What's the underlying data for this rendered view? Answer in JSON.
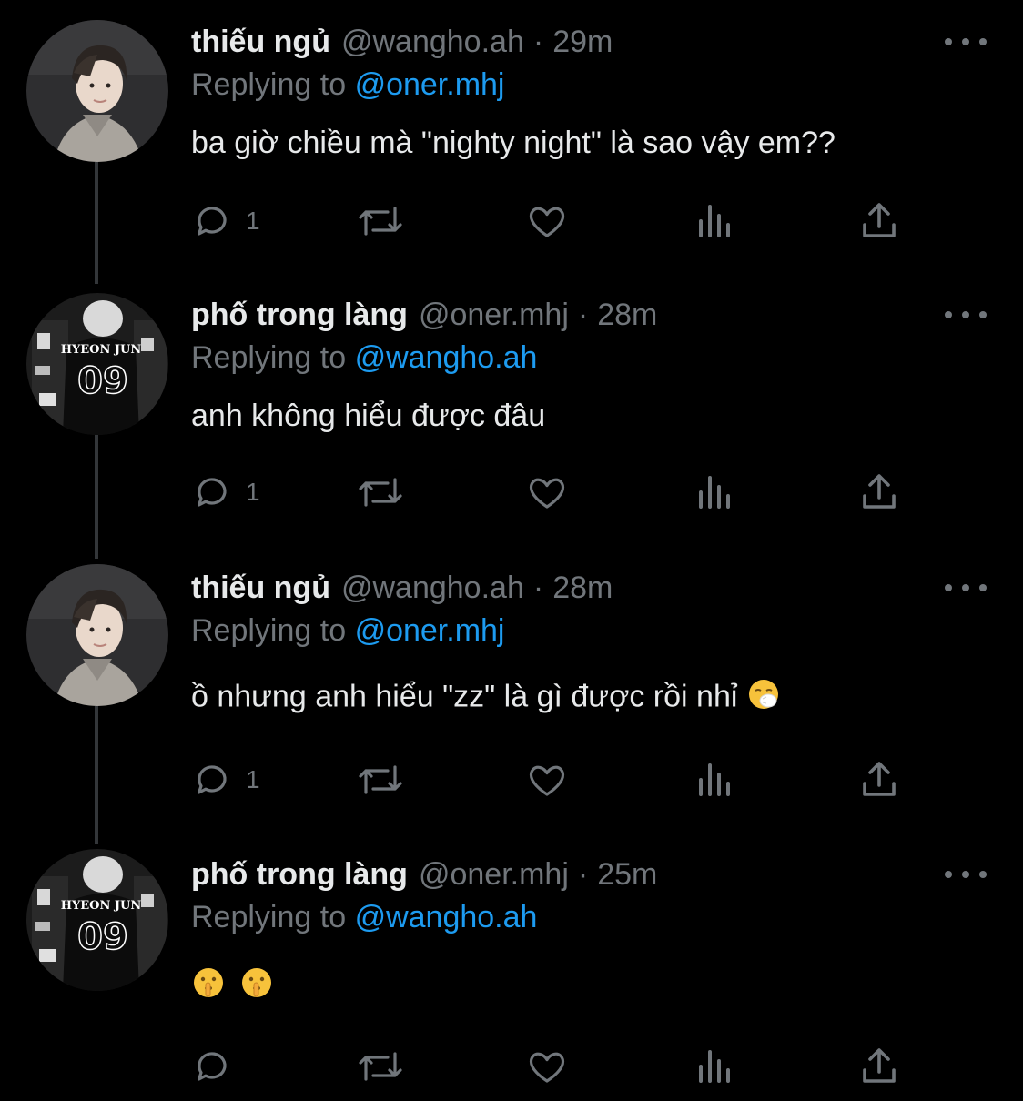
{
  "tweets": [
    {
      "name": "thiếu ngủ",
      "handle": "@wangho.ah",
      "separator": "·",
      "time": "29m",
      "replying_prefix": "Replying to",
      "replying_to": "@oner.mhj",
      "text": "ba giờ chiều mà \"nighty night\" là sao vậy em??",
      "reply_count": "1",
      "avatar": "avatar-boy-hoodie"
    },
    {
      "name": "phố trong làng",
      "handle": "@oner.mhj",
      "separator": "·",
      "time": "28m",
      "replying_prefix": "Replying to",
      "replying_to": "@wangho.ah",
      "text": "anh không hiểu được đâu",
      "reply_count": "1",
      "avatar": "avatar-jersey-hyeon-jun-09",
      "avatar_jersey_name": "HYEON JUN",
      "avatar_jersey_number": "09"
    },
    {
      "name": "thiếu ngủ",
      "handle": "@wangho.ah",
      "separator": "·",
      "time": "28m",
      "replying_prefix": "Replying to",
      "replying_to": "@oner.mhj",
      "text": "ồ nhưng anh hiểu \"zz\" là gì được rồi nhỉ",
      "text_emoji": "sneezing-face-emoji",
      "reply_count": "1",
      "avatar": "avatar-boy-hoodie"
    },
    {
      "name": "phố trong làng",
      "handle": "@oner.mhj",
      "separator": "·",
      "time": "25m",
      "replying_prefix": "Replying to",
      "replying_to": "@wangho.ah",
      "text_emojis": [
        "shushing-face-emoji",
        "shushing-face-emoji"
      ],
      "reply_count": "",
      "avatar": "avatar-jersey-hyeon-jun-09",
      "avatar_jersey_name": "HYEON JUN",
      "avatar_jersey_number": "09"
    }
  ],
  "icons": {
    "reply": "speech-bubble-icon",
    "retweet": "retweet-icon",
    "like": "heart-icon",
    "views": "bar-chart-icon",
    "share": "share-upload-icon",
    "more": "more-dots-icon"
  },
  "colors": {
    "background": "#000000",
    "text": "#e7e9ea",
    "muted": "#71767b",
    "link": "#1d9bf0",
    "thread_line": "#333639"
  }
}
